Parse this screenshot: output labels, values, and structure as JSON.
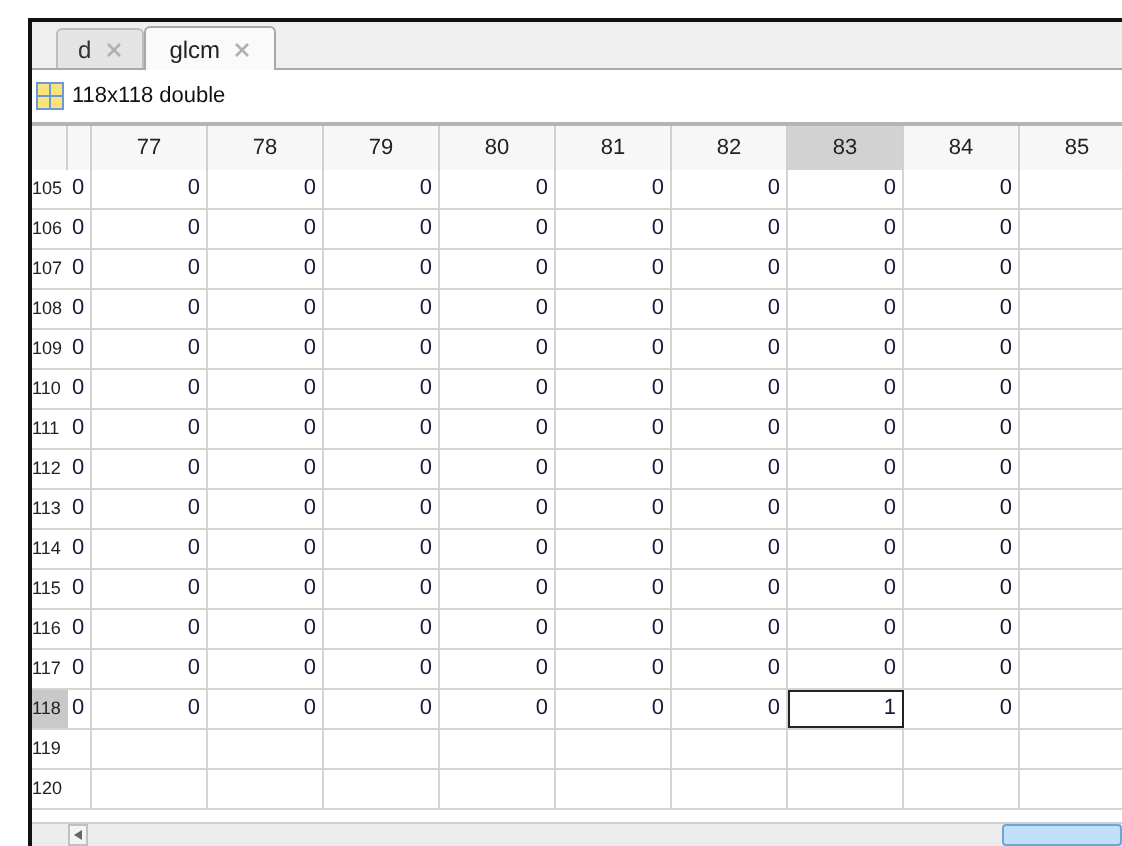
{
  "tabs": [
    {
      "label": "d",
      "selected": false
    },
    {
      "label": "glcm",
      "selected": true
    }
  ],
  "variable": {
    "description": "118x118 double"
  },
  "table": {
    "columns": [
      {
        "selected": false
      },
      {
        "label": "77",
        "selected": false
      },
      {
        "label": "78",
        "selected": false
      },
      {
        "label": "79",
        "selected": false
      },
      {
        "label": "80",
        "selected": false
      },
      {
        "label": "81",
        "selected": false
      },
      {
        "label": "82",
        "selected": false
      },
      {
        "label": "83",
        "selected": true
      },
      {
        "label": "84",
        "selected": false
      },
      {
        "label": "85",
        "selected": false
      }
    ],
    "rows": [
      {
        "label": "105",
        "selected": false,
        "cells": [
          "0",
          "0",
          "0",
          "0",
          "0",
          "0",
          "0",
          "0",
          "0"
        ]
      },
      {
        "label": "106",
        "selected": false,
        "cells": [
          "0",
          "0",
          "0",
          "0",
          "0",
          "0",
          "0",
          "0",
          "0"
        ]
      },
      {
        "label": "107",
        "selected": false,
        "cells": [
          "0",
          "0",
          "0",
          "0",
          "0",
          "0",
          "0",
          "0",
          "0"
        ]
      },
      {
        "label": "108",
        "selected": false,
        "cells": [
          "0",
          "0",
          "0",
          "0",
          "0",
          "0",
          "0",
          "0",
          "0"
        ]
      },
      {
        "label": "109",
        "selected": false,
        "cells": [
          "0",
          "0",
          "0",
          "0",
          "0",
          "0",
          "0",
          "0",
          "0"
        ]
      },
      {
        "label": "110",
        "selected": false,
        "cells": [
          "0",
          "0",
          "0",
          "0",
          "0",
          "0",
          "0",
          "0",
          "0"
        ]
      },
      {
        "label": "111",
        "selected": false,
        "cells": [
          "0",
          "0",
          "0",
          "0",
          "0",
          "0",
          "0",
          "0",
          "0"
        ]
      },
      {
        "label": "112",
        "selected": false,
        "cells": [
          "0",
          "0",
          "0",
          "0",
          "0",
          "0",
          "0",
          "0",
          "0"
        ]
      },
      {
        "label": "113",
        "selected": false,
        "cells": [
          "0",
          "0",
          "0",
          "0",
          "0",
          "0",
          "0",
          "0",
          "0"
        ]
      },
      {
        "label": "114",
        "selected": false,
        "cells": [
          "0",
          "0",
          "0",
          "0",
          "0",
          "0",
          "0",
          "0",
          "0"
        ]
      },
      {
        "label": "115",
        "selected": false,
        "cells": [
          "0",
          "0",
          "0",
          "0",
          "0",
          "0",
          "0",
          "0",
          "0"
        ]
      },
      {
        "label": "116",
        "selected": false,
        "cells": [
          "0",
          "0",
          "0",
          "0",
          "0",
          "0",
          "0",
          "0",
          "0"
        ]
      },
      {
        "label": "117",
        "selected": false,
        "cells": [
          "0",
          "0",
          "0",
          "0",
          "0",
          "0",
          "0",
          "0",
          "0"
        ]
      },
      {
        "label": "118",
        "selected": true,
        "cells": [
          "0",
          "0",
          "0",
          "0",
          "0",
          "0",
          "0",
          "1",
          "0"
        ]
      },
      {
        "label": "119",
        "selected": false
      },
      {
        "label": "120",
        "selected": false
      }
    ]
  }
}
